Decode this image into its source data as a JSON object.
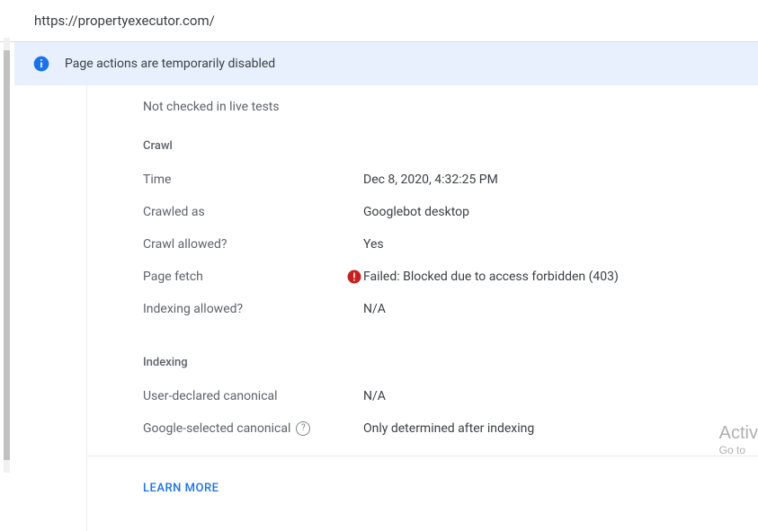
{
  "url": "https://propertyexecutor.com/",
  "banner": {
    "message": "Page actions are temporarily disabled"
  },
  "top_note": "Not checked in live tests",
  "sections": {
    "crawl": {
      "title": "Crawl",
      "rows": {
        "time_label": "Time",
        "time_value": "Dec 8, 2020, 4:32:25 PM",
        "crawled_as_label": "Crawled as",
        "crawled_as_value": "Googlebot desktop",
        "crawl_allowed_label": "Crawl allowed?",
        "crawl_allowed_value": "Yes",
        "page_fetch_label": "Page fetch",
        "page_fetch_value": "Failed: Blocked due to access forbidden (403)",
        "indexing_allowed_label": "Indexing allowed?",
        "indexing_allowed_value": "N/A"
      }
    },
    "indexing": {
      "title": "Indexing",
      "rows": {
        "user_canonical_label": "User-declared canonical",
        "user_canonical_value": "N/A",
        "google_canonical_label": "Google-selected canonical",
        "google_canonical_value": "Only determined after indexing"
      }
    }
  },
  "learn_more": "LEARN MORE",
  "watermark": {
    "line1": "Activ",
    "line2": "Go to"
  }
}
